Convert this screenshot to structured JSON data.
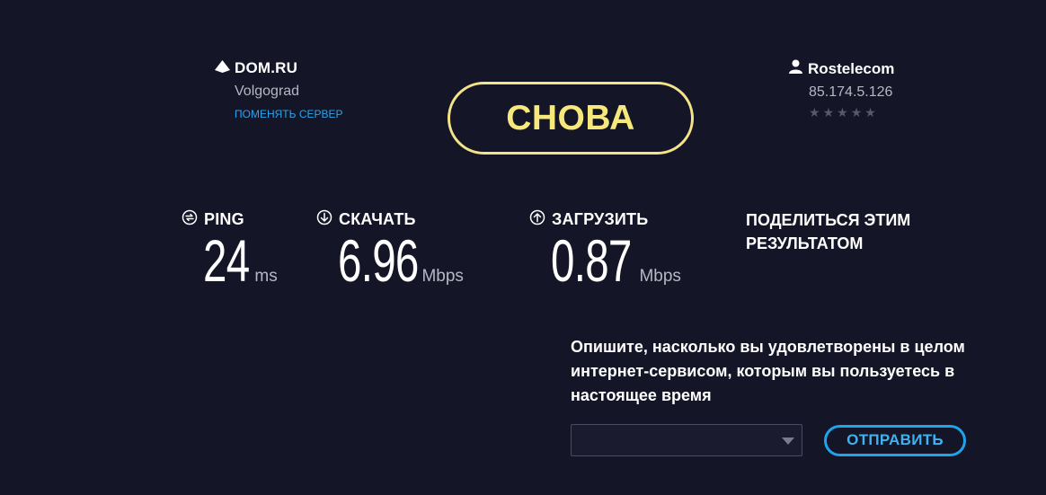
{
  "server": {
    "name": "DOM.RU",
    "city": "Volgograd",
    "change_label": "ПОМЕНЯТЬ СЕРВЕР"
  },
  "isp": {
    "name": "Rostelecom",
    "ip": "85.174.5.126",
    "rating": 0,
    "rating_max": 5
  },
  "again_button": {
    "label": "СНОВА",
    "color": "#f7e87c"
  },
  "metrics": {
    "ping": {
      "label": "PING",
      "value": "24",
      "unit": "ms"
    },
    "download": {
      "label": "СКАЧАТЬ",
      "value": "6.96",
      "unit": "Mbps"
    },
    "upload": {
      "label": "ЗАГРУЗИТЬ",
      "value": "0.87",
      "unit": "Mbps"
    }
  },
  "share": {
    "label": "ПОДЕЛИТЬСЯ ЭТИМ РЕЗУЛЬТАТОМ"
  },
  "survey": {
    "question": "Опишите, насколько вы удовлетворены в целом интернет-сервисом, которым вы пользуетесь в настоящее время",
    "selected_value": "",
    "submit_label": "ОТПРАВИТЬ"
  },
  "colors": {
    "background": "#141526",
    "accent_yellow": "#f3e48a",
    "accent_blue": "#1fa3ec",
    "muted_text": "#b6b7c4"
  },
  "icons": {
    "server": "server-triangle-icon",
    "isp": "person-icon",
    "ping": "ping-icon",
    "download": "download-arrow-icon",
    "upload": "upload-arrow-icon"
  }
}
